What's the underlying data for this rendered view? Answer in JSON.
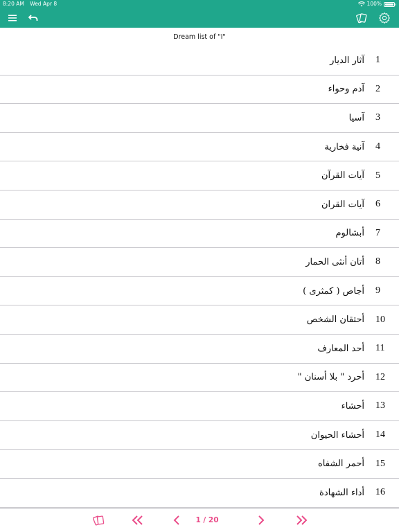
{
  "status_bar": {
    "time": "8:20 AM",
    "date": "Wed Apr 8",
    "battery": "100%"
  },
  "toolbar": {
    "menu_icon": "hamburger-menu-icon",
    "back_icon": "undo-arrow-icon",
    "cards_icon": "cards-icon",
    "settings_icon": "gear-icon"
  },
  "header": {
    "subtitle": "Dream list of \"ا\""
  },
  "list": {
    "items": [
      {
        "number": "1",
        "label": "آثار الديار"
      },
      {
        "number": "2",
        "label": "آدم وحواء"
      },
      {
        "number": "3",
        "label": "آسيا"
      },
      {
        "number": "4",
        "label": "آنية فخارية"
      },
      {
        "number": "5",
        "label": "آيات القرآن"
      },
      {
        "number": "6",
        "label": "آيات القران"
      },
      {
        "number": "7",
        "label": "أبشالوم"
      },
      {
        "number": "8",
        "label": "أتان أنثى الحمار"
      },
      {
        "number": "9",
        "label": "أجاص ( كمثرى )"
      },
      {
        "number": "10",
        "label": "أحتقان الشخص"
      },
      {
        "number": "11",
        "label": "أحد المعارف"
      },
      {
        "number": "12",
        "label": "أحرد \" بلا أسنان \""
      },
      {
        "number": "13",
        "label": "أحشاء"
      },
      {
        "number": "14",
        "label": "أحشاء الحيوان"
      },
      {
        "number": "15",
        "label": "أحمر الشفاه"
      },
      {
        "number": "16",
        "label": "أداء الشهادة"
      }
    ]
  },
  "footer": {
    "pager": "1 / 20",
    "accent": "#ea4c89",
    "icons": [
      "cards-icon",
      "double-chevron-left-icon",
      "chevron-left-icon",
      "chevron-right-icon",
      "double-chevron-right-icon"
    ]
  },
  "colors": {
    "header_bg": "#1fa78c",
    "accent": "#ea4c89"
  }
}
